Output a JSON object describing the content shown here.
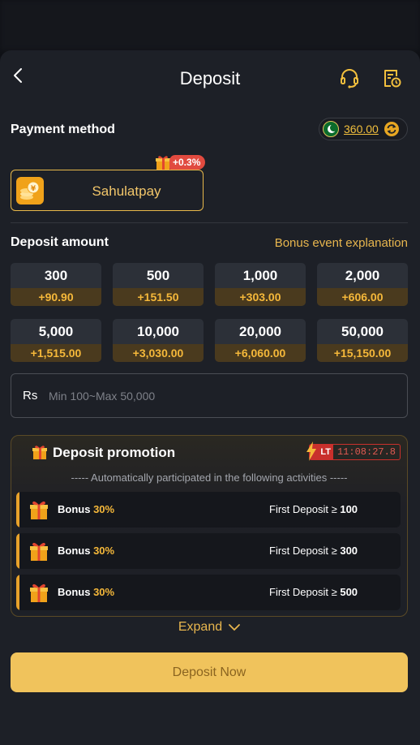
{
  "background_nav": {
    "tabs": [
      "",
      "",
      "",
      "",
      ""
    ]
  },
  "header": {
    "title": "Deposit",
    "back_icon": "chevron-left-icon",
    "support_icon": "headset-icon",
    "records_icon": "history-document-icon"
  },
  "payment_method": {
    "label": "Payment method",
    "balance": "360.00",
    "currency_flag": "pakistan-flag-icon",
    "refresh_icon": "refresh-icon",
    "methods": [
      {
        "name": "Sahulatpay",
        "badge": "+0.3%",
        "logo": "coin-stack-icon"
      }
    ]
  },
  "deposit_amount": {
    "label": "Deposit amount",
    "bonus_link": "Bonus event explanation",
    "tiles": [
      {
        "amount": "300",
        "bonus": "+90.90"
      },
      {
        "amount": "500",
        "bonus": "+151.50"
      },
      {
        "amount": "1,000",
        "bonus": "+303.00"
      },
      {
        "amount": "2,000",
        "bonus": "+606.00"
      },
      {
        "amount": "5,000",
        "bonus": "+1,515.00"
      },
      {
        "amount": "10,000",
        "bonus": "+3,030.00"
      },
      {
        "amount": "20,000",
        "bonus": "+6,060.00"
      },
      {
        "amount": "50,000",
        "bonus": "+15,150.00"
      }
    ],
    "input": {
      "currency": "Rs",
      "placeholder": "Min 100~Max 50,000",
      "value": ""
    }
  },
  "promotion": {
    "title": "Deposit promotion",
    "timer_label": "LT",
    "timer_value": "11:08:27.8",
    "subtitle": "----- Automatically participated in the following activities -----",
    "items": [
      {
        "label": "Bonus",
        "percent": "30%",
        "condition_text": "First Deposit ≥",
        "condition_value": "100"
      },
      {
        "label": "Bonus",
        "percent": "30%",
        "condition_text": "First Deposit ≥",
        "condition_value": "300"
      },
      {
        "label": "Bonus",
        "percent": "30%",
        "condition_text": "First Deposit ≥",
        "condition_value": "500"
      }
    ],
    "expand_label": "Expand"
  },
  "submit": {
    "label": "Deposit Now"
  },
  "colors": {
    "accent_gold": "#f0c35c",
    "bonus_orange": "#f5b83a",
    "timer_red": "#c9302c",
    "sheet_bg": "#1d2027"
  }
}
